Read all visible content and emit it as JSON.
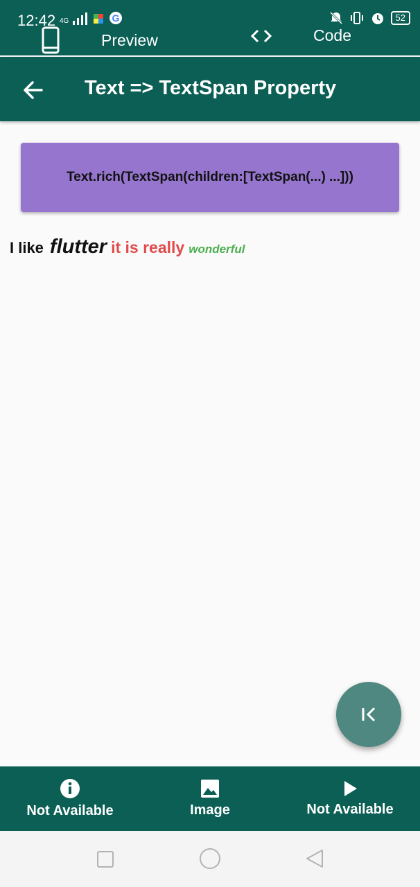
{
  "status": {
    "time": "12:42",
    "network": "4G",
    "battery": "52"
  },
  "tabs": {
    "preview_label": "Preview",
    "code_label": "Code"
  },
  "appbar": {
    "title": "Text => TextSpan Property"
  },
  "code_card": {
    "text": "Text.rich(TextSpan(children:[TextSpan(...) ...]))"
  },
  "rich_text": {
    "span1": "I like",
    "span2": "flutter",
    "span3": "it is really",
    "span4": "wonderful"
  },
  "bottom_nav": [
    {
      "label": "Not Available",
      "icon": "info-icon"
    },
    {
      "label": "Image",
      "icon": "image-icon"
    },
    {
      "label": "Not Available",
      "icon": "play-icon"
    }
  ],
  "colors": {
    "primary": "#0b5f55",
    "card": "#9575cd",
    "fab": "#4f8880",
    "red_span": "#e04b4b",
    "green_span": "#4caf50"
  }
}
